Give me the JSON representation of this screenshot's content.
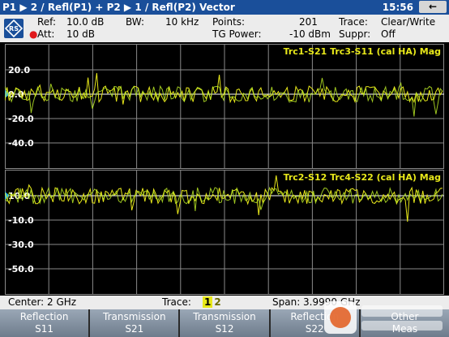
{
  "title": "P1 ▶ 2 / Refl(P1) + P2 ▶ 1 / Refl(P2) Vector",
  "time": "15:56",
  "back_icon": "back-arrow-icon",
  "logo": "rohde-schwarz-logo",
  "settings": {
    "ref_label": "Ref:",
    "ref_value": "10.0 dB",
    "att_label": "Att:",
    "att_value": "10 dB",
    "bw_label": "BW:",
    "bw_value": "10 kHz",
    "points_label": "Points:",
    "points_value": "201",
    "tg_label": "TG Power:",
    "tg_value": "-10 dBm",
    "trace_label": "Trace:",
    "trace_value": "Clear/Write",
    "suppr_label": "Suppr:",
    "suppr_value": "Off"
  },
  "plot1": {
    "legend": "Trc1-S21 Trc3-S11 (cal HA) Mag",
    "y_labels": [
      "20.0",
      "0.0",
      "-20.0",
      "-40.0"
    ],
    "ref_level": "0.0"
  },
  "plot2": {
    "legend": "Trc2-S12 Trc4-S22 (cal HA) Mag",
    "y_labels": [
      "10.0",
      "-10.0",
      "-30.0",
      "-50.0"
    ],
    "ref_level": "10.0"
  },
  "bottom": {
    "center": "Center: 2 GHz",
    "trace_label": "Trace:",
    "trace_1": "1",
    "trace_2": "2",
    "span": "Span:   3.9990 GHz"
  },
  "softkeys": [
    {
      "line1": "Reflection",
      "line2": "S11"
    },
    {
      "line1": "Transmission",
      "line2": "S21"
    },
    {
      "line1": "Transmission",
      "line2": "S12"
    },
    {
      "line1": "Reflection",
      "line2": "S22"
    },
    {
      "line1": "Other",
      "line2": "Meas"
    }
  ],
  "colors": {
    "title_bg": "#1a4f9a",
    "trace_yellow": "#e8e81a",
    "trace_green": "#b8e826",
    "grid": "#8a8a8a",
    "legend": "#e8e81a",
    "ref_marker": "#27b3e8"
  }
}
